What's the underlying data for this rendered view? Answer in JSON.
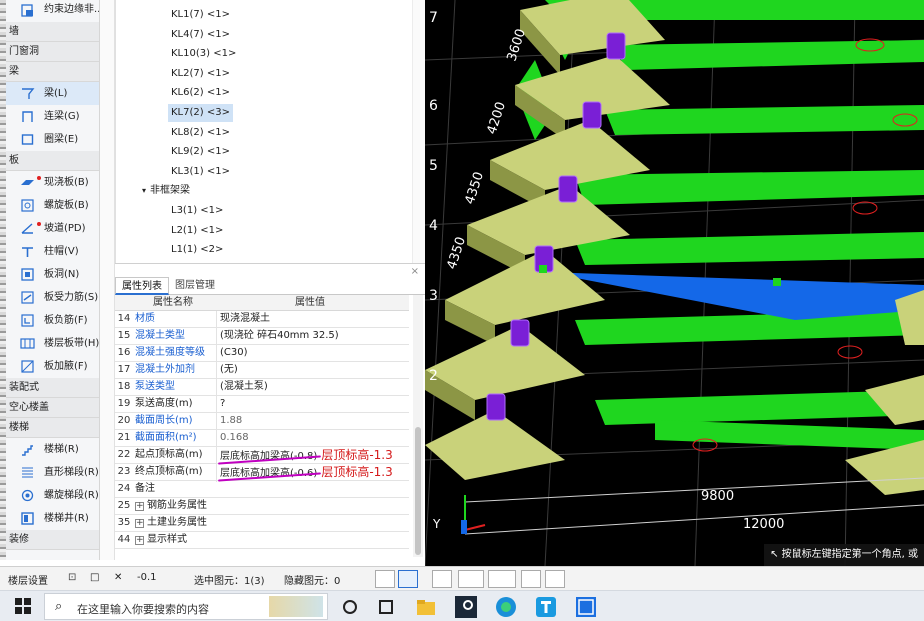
{
  "sidebar": {
    "top_item": "约束边缘非...",
    "sections": [
      {
        "type": "cat",
        "label": "墙"
      },
      {
        "type": "cat",
        "label": "门窗洞"
      },
      {
        "type": "cat",
        "label": "梁"
      },
      {
        "type": "item",
        "label": "梁(L)",
        "icon": "beam-icon",
        "selected": true
      },
      {
        "type": "item",
        "label": "连梁(G)",
        "icon": "link-beam-icon"
      },
      {
        "type": "item",
        "label": "圈梁(E)",
        "icon": "ring-beam-icon"
      },
      {
        "type": "cat",
        "label": "板"
      },
      {
        "type": "item",
        "label": "现浇板(B)",
        "icon": "cast-slab-icon",
        "dot": true
      },
      {
        "type": "item",
        "label": "螺旋板(B)",
        "icon": "spiral-slab-icon"
      },
      {
        "type": "item",
        "label": "坡道(PD)",
        "icon": "ramp-icon",
        "dot": true
      },
      {
        "type": "item",
        "label": "柱帽(V)",
        "icon": "column-cap-icon"
      },
      {
        "type": "item",
        "label": "板洞(N)",
        "icon": "slab-hole-icon"
      },
      {
        "type": "item",
        "label": "板受力筋(S)",
        "icon": "slab-rebar-icon"
      },
      {
        "type": "item",
        "label": "板负筋(F)",
        "icon": "negative-rebar-icon"
      },
      {
        "type": "item",
        "label": "楼层板带(H)",
        "icon": "slab-strip-icon"
      },
      {
        "type": "item",
        "label": "板加腋(F)",
        "icon": "slab-haunch-icon"
      },
      {
        "type": "cat",
        "label": "装配式"
      },
      {
        "type": "cat",
        "label": "空心楼盖"
      },
      {
        "type": "cat",
        "label": "楼梯"
      },
      {
        "type": "item",
        "label": "楼梯(R)",
        "icon": "stair-icon"
      },
      {
        "type": "item",
        "label": "直形梯段(R)",
        "icon": "straight-flight-icon"
      },
      {
        "type": "item",
        "label": "螺旋梯段(R)",
        "icon": "spiral-flight-icon"
      },
      {
        "type": "item",
        "label": "楼梯井(R)",
        "icon": "stair-well-icon"
      },
      {
        "type": "cat",
        "label": "装修"
      }
    ]
  },
  "tree": {
    "nodes_a": [
      "KL1(7) <1>",
      "KL4(7) <1>",
      "KL10(3) <1>",
      "KL2(7) <1>",
      "KL6(2) <1>"
    ],
    "selected": "KL7(2) <3>",
    "nodes_b": [
      "KL8(2) <1>",
      "KL9(2) <1>",
      "KL3(1) <1>"
    ],
    "group": "非框架梁",
    "nodes_c": [
      "L3(1) <1>",
      "L2(1) <1>",
      "L1(1) <2>"
    ]
  },
  "props": {
    "close": "×",
    "tabs": [
      "属性列表",
      "图层管理"
    ],
    "header_name": "属性名称",
    "header_value": "属性值",
    "rows": [
      {
        "num": "14",
        "name": "材质",
        "value": "现浇混凝土",
        "link": true
      },
      {
        "num": "15",
        "name": "混凝土类型",
        "value": "(现浇砼 碎石40mm 32.5)",
        "link": true
      },
      {
        "num": "16",
        "name": "混凝土强度等级",
        "value": "(C30)",
        "link": true
      },
      {
        "num": "17",
        "name": "混凝土外加剂",
        "value": "(无)",
        "link": true
      },
      {
        "num": "18",
        "name": "泵送类型",
        "value": "(混凝土泵)",
        "link": true
      },
      {
        "num": "19",
        "name": "泵送高度(m)",
        "value": "?"
      },
      {
        "num": "20",
        "name": "截面周长(m)",
        "value": "1.88",
        "link": true,
        "gray": true
      },
      {
        "num": "21",
        "name": "截面面积(m²)",
        "value": "0.168",
        "link": true,
        "gray": true
      },
      {
        "num": "22",
        "name": "起点顶标高(m)",
        "value": "层底标高加梁高(-0.8)",
        "annot": "层顶标高-1.3"
      },
      {
        "num": "23",
        "name": "终点顶标高(m)",
        "value": "层底标高加梁高(-0.6)",
        "annot": "层顶标高-1.3"
      },
      {
        "num": "24",
        "name": "备注",
        "value": ""
      },
      {
        "num": "25",
        "name": "钢筋业务属性",
        "value": "",
        "expand": true
      },
      {
        "num": "35",
        "name": "土建业务属性",
        "value": "",
        "expand": true
      },
      {
        "num": "44",
        "name": "显示样式",
        "value": "",
        "expand": true
      }
    ]
  },
  "viewport": {
    "axis_left": [
      "7",
      "6",
      "5",
      "4",
      "3",
      "2"
    ],
    "dims_left": [
      "3600",
      "4200",
      "4350",
      "4350"
    ],
    "dims_bottom": [
      "9800",
      "12000"
    ],
    "hint": "按鼠标左键指定第一个角点, 或",
    "axis_y": "Y",
    "colors": {
      "beam_green": "#1fd61f",
      "cap_olive": "#a7b35a",
      "cap_light": "#c9d27a",
      "column_purple": "#7a1fd6",
      "slab_blue": "#1468e8"
    }
  },
  "statusbar": {
    "layer_settings": "楼层设置",
    "elev": "-0.1",
    "selected": "选中图元：1(3)",
    "hidden": "隐藏图元：0"
  },
  "taskbar": {
    "search_placeholder": "在这里输入你要搜索的内容"
  }
}
